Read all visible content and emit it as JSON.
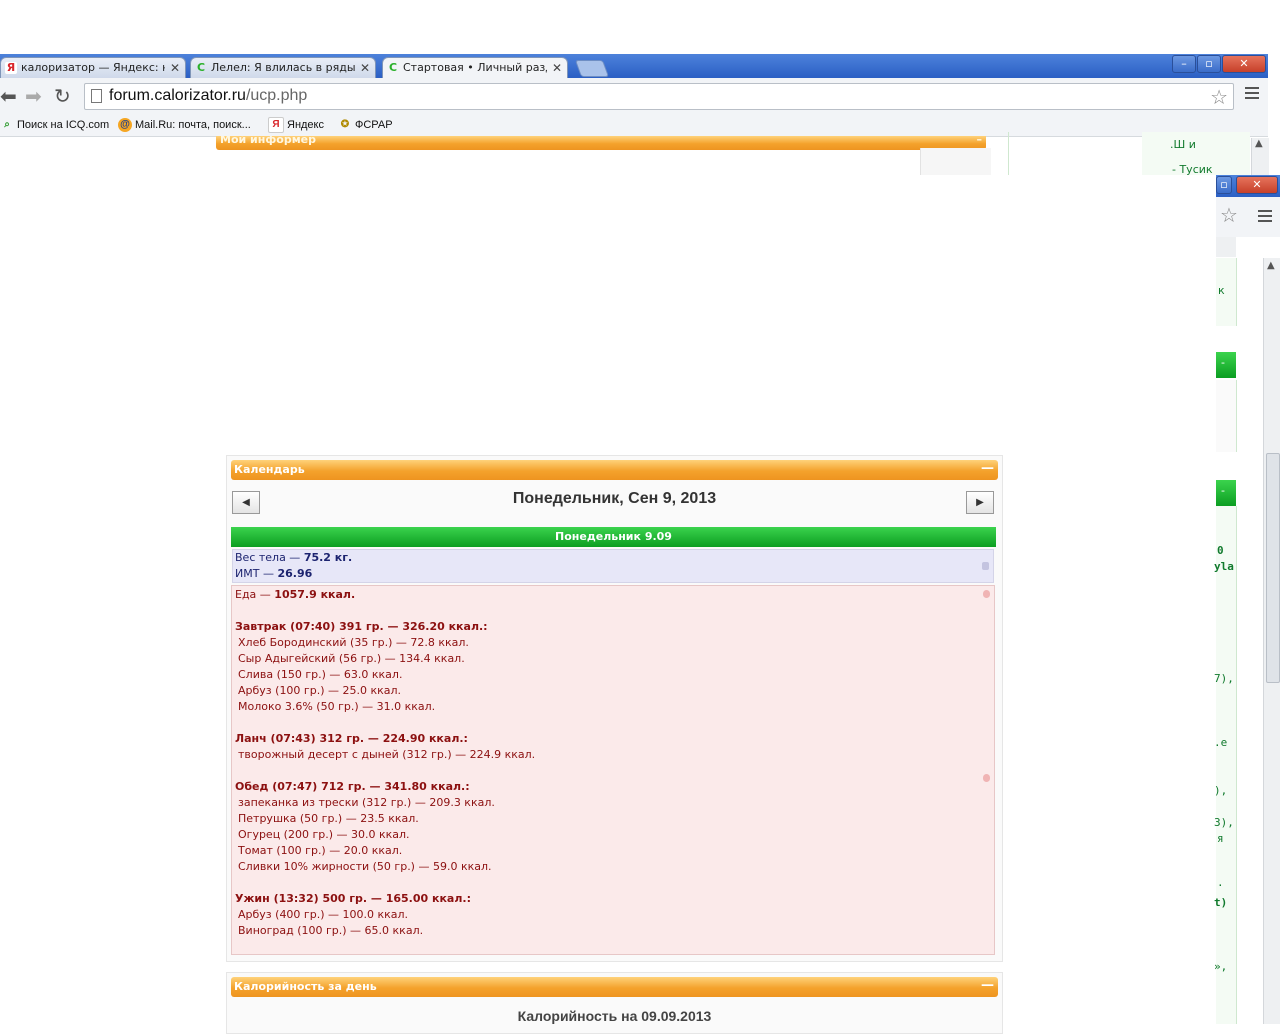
{
  "browser": {
    "tabs": [
      {
        "title": "калоризатор — Яндекс: на",
        "favicon": "Я",
        "favicon_color": "#d9262c"
      },
      {
        "title": "Лелел: Я влилась в ряды",
        "favicon": "C",
        "favicon_color": "#2bb02b"
      },
      {
        "title": "Стартовая • Личный разде",
        "favicon": "C",
        "favicon_color": "#2bb02b"
      }
    ],
    "url_host": "forum.calorizator.ru",
    "url_path": "/ucp.php",
    "bookmarks": [
      "Поиск на ICQ.com",
      "Mail.Ru: почта, поиск...",
      "Яндекс",
      "ФСРАР"
    ],
    "window_buttons": [
      "–",
      "▫",
      "✕"
    ]
  },
  "background": {
    "informer_title": "Мой информер",
    "right_snippets": [
      ".Ш и",
      "- Тусик",
      "к",
      "0",
      "yla",
      "7),",
      ".e",
      "),",
      "3),",
      "я",
      ".",
      "t)",
      "»,"
    ]
  },
  "calendar": {
    "panel_title": "Календарь",
    "date_title": "Понедельник, Сен 9, 2013",
    "day_bar": "Понедельник 9.09",
    "weight_label": "Вес тела",
    "weight_value": "75.2 кг.",
    "bmi_label": "ИМТ",
    "bmi_value": "26.96",
    "food_label": "Еда",
    "food_value": "1057.9 ккал.",
    "meals": [
      {
        "header": "Завтрак (07:40) 391 гр. — 326.20 ккал.:",
        "items": [
          "Хлеб Бородинский (35 гр.) — 72.8 ккал.",
          "Сыр Адыгейский (56 гр.) — 134.4 ккал.",
          "Слива (150 гр.) — 63.0 ккал.",
          "Арбуз (100 гр.) — 25.0 ккал.",
          "Молоко 3.6% (50 гр.) — 31.0 ккал."
        ]
      },
      {
        "header": "Ланч (07:43) 312 гр. — 224.90 ккал.:",
        "items": [
          "творожный десерт с дыней (312 гр.) — 224.9 ккал."
        ]
      },
      {
        "header": "Обед (07:47) 712 гр. — 341.80 ккал.:",
        "items": [
          "запеканка из трески (312 гр.) — 209.3 ккал.",
          "Петрушка (50 гр.) — 23.5 ккал.",
          "Огурец (200 гр.) — 30.0 ккал.",
          "Томат (100 гр.) — 20.0 ккал.",
          "Сливки 10% жирности (50 гр.) — 59.0 ккал."
        ]
      },
      {
        "header": "Ужин (13:32) 500 гр. — 165.00 ккал.:",
        "items": [
          "Арбуз (400 гр.) — 100.0 ккал.",
          "Виноград (100 гр.) — 65.0 ккал."
        ]
      }
    ],
    "prev_symbol": "◀",
    "next_symbol": "▶",
    "collapse_symbol": "—"
  },
  "calories": {
    "panel_title": "Калорийность за день",
    "title": "Калорийность на 09.09.2013"
  },
  "colors": {
    "accent_orange": "#f4a22c",
    "accent_green": "#13a82a",
    "food_text": "#8c1010",
    "body_text": "#1d2470"
  }
}
